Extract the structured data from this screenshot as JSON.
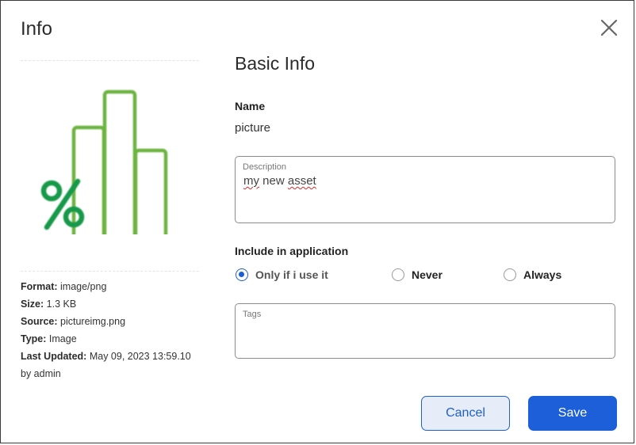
{
  "dialog": {
    "title": "Info",
    "close_icon": "close-icon"
  },
  "preview": {
    "icon": "percent-bar-chart-icon",
    "accent_color": "#6db33f",
    "percent_color": "#16994a"
  },
  "meta": {
    "format_label": "Format:",
    "format_value": "image/png",
    "size_label": "Size:",
    "size_value": "1.3 KB",
    "source_label": "Source:",
    "source_value": "pictureimg.png",
    "type_label": "Type:",
    "type_value": "Image",
    "updated_label": "Last Updated:",
    "updated_value": "May 09, 2023 13:59.10",
    "updated_by": "by admin"
  },
  "basic_info": {
    "title": "Basic Info",
    "name_label": "Name",
    "name_value": "picture",
    "description_label": "Description",
    "description_word1": "my",
    "description_word2": "new",
    "description_word3": "asset",
    "include_label": "Include in application",
    "include_options": [
      {
        "label": "Only if i use it",
        "selected": true
      },
      {
        "label": "Never",
        "selected": false
      },
      {
        "label": "Always",
        "selected": false
      }
    ],
    "tags_label": "Tags",
    "tags_value": ""
  },
  "actions": {
    "cancel_label": "Cancel",
    "save_label": "Save",
    "primary_color": "#1d5fd8"
  }
}
